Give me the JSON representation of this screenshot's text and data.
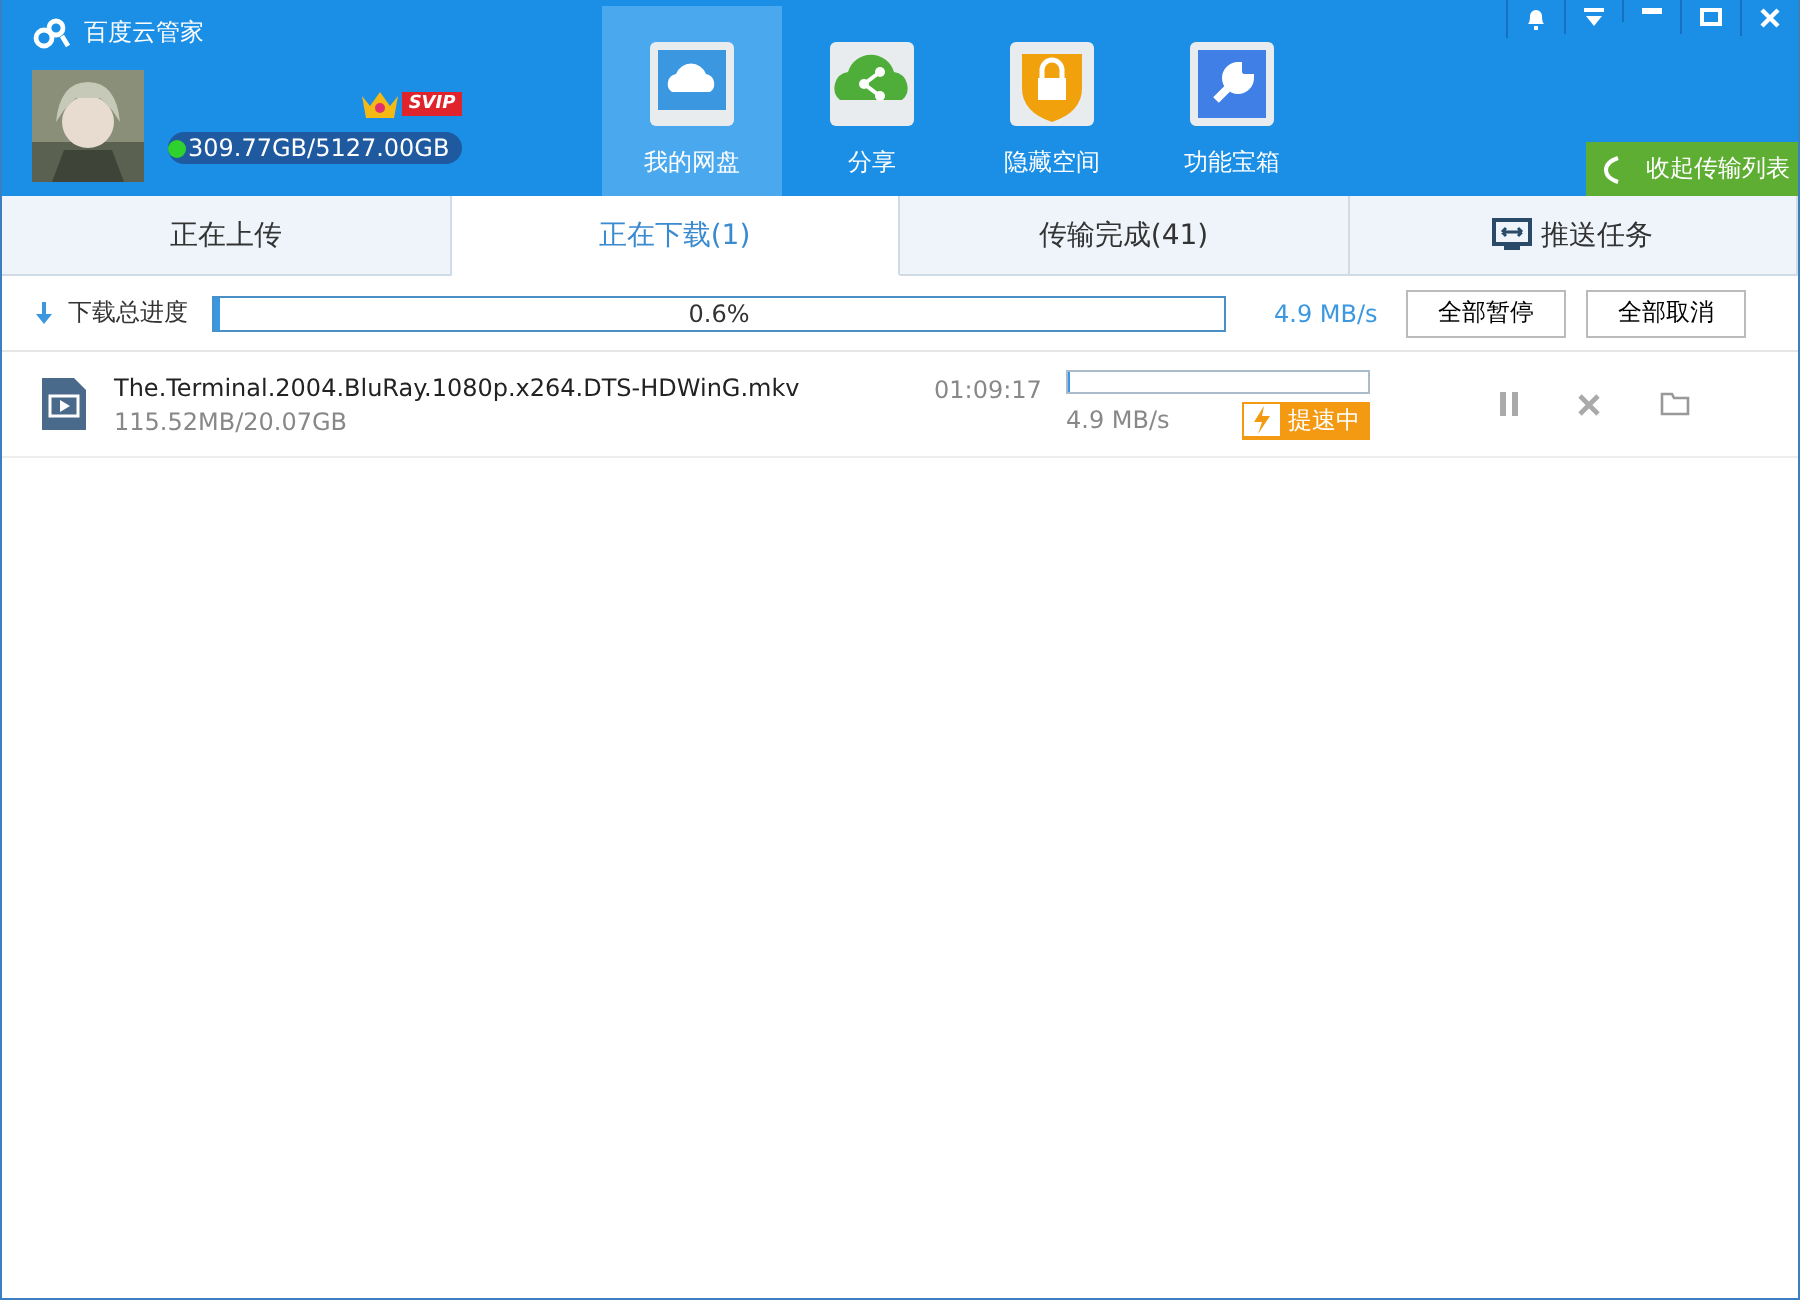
{
  "app": {
    "title": "百度云管家",
    "badge": "SVIP",
    "quota": "309.77GB/5127.00GB",
    "online": true
  },
  "nav": [
    {
      "label": "我的网盘",
      "kind": "cloud",
      "selected": true
    },
    {
      "label": "分享",
      "kind": "share",
      "selected": false
    },
    {
      "label": "隐藏空间",
      "kind": "lock",
      "selected": false
    },
    {
      "label": "功能宝箱",
      "kind": "wrench",
      "selected": false
    }
  ],
  "collapse_button": "收起传输列表",
  "tabs": [
    {
      "label": "正在上传",
      "selected": false,
      "kind": "plain"
    },
    {
      "label": "正在下载(1)",
      "selected": true,
      "kind": "plain"
    },
    {
      "label": "传输完成(41)",
      "selected": false,
      "kind": "plain"
    },
    {
      "label": "推送任务",
      "selected": false,
      "kind": "push"
    }
  ],
  "summary": {
    "label": "下载总进度",
    "percent": "0.6%",
    "level": 0.006,
    "speed": "4.9 MB/s",
    "buttons": [
      "全部暂停",
      "全部取消"
    ]
  },
  "downloads": [
    {
      "name": "The.Terminal.2004.BluRay.1080p.x264.DTS-HDWinG.mkv",
      "size": "115.52MB/20.07GB",
      "time": "01:09:17",
      "level": 0.006,
      "speed": "4.9 MB/s",
      "boost": "提速中"
    }
  ]
}
